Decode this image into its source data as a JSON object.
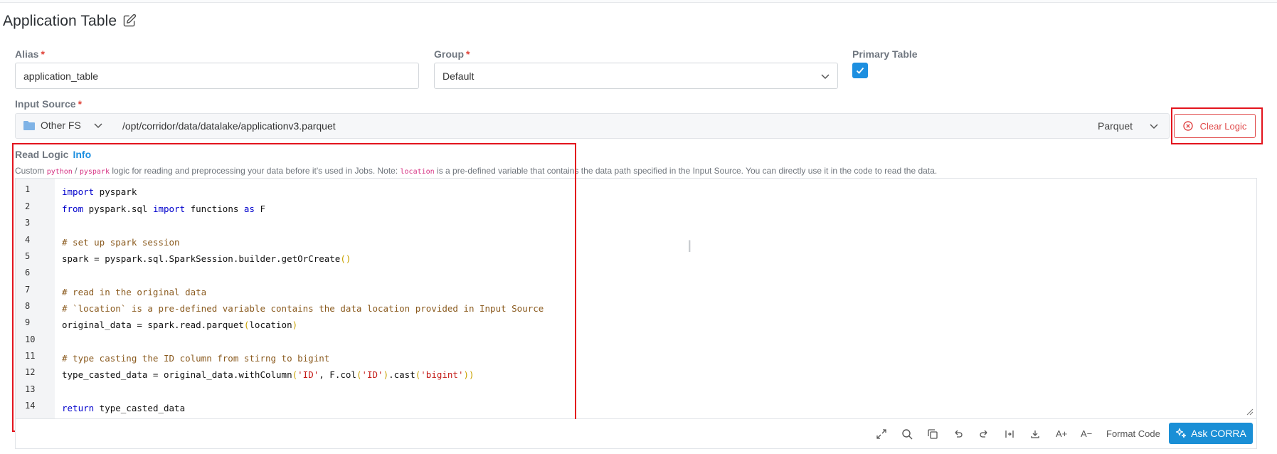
{
  "header": {
    "title": "Application Table"
  },
  "alias": {
    "label": "Alias",
    "required_mark": "*",
    "value": "application_table"
  },
  "group": {
    "label": "Group",
    "required_mark": "*",
    "value": "Default"
  },
  "primary_table": {
    "label": "Primary Table",
    "checked": true
  },
  "input_source": {
    "label": "Input Source",
    "required_mark": "*",
    "fs_type": "Other FS",
    "path": "/opt/corridor/data/datalake/applicationv3.parquet",
    "format": "Parquet"
  },
  "clear_logic": {
    "label": "Clear Logic"
  },
  "read_logic": {
    "label": "Read Logic",
    "info_label": "Info",
    "desc_prefix": "Custom ",
    "desc_python": "python",
    "desc_sep": " / ",
    "desc_pyspark": "pyspark",
    "desc_mid": " logic for reading and preprocessing your data before it's used in Jobs. Note: ",
    "desc_location": "location",
    "desc_suffix": " is a pre-defined variable that contains the data path specified in the Input Source. You can directly use it in the code to read the data."
  },
  "code": {
    "line_numbers": [
      "1",
      "2",
      "3",
      "4",
      "5",
      "6",
      "7",
      "8",
      "9",
      "10",
      "11",
      "12",
      "13",
      "14"
    ],
    "l1_kw": "import",
    "l1_rest": " pyspark",
    "l2_kw1": "from",
    "l2_mid": " pyspark.sql ",
    "l2_kw2": "import",
    "l2_mid2": " functions ",
    "l2_kw3": "as",
    "l2_end": " F",
    "l4": "# set up spark session",
    "l5_a": "spark = pyspark.sql.SparkSession.builder.getOrCreate",
    "l5_p": "()",
    "l7": "# read in the original data",
    "l8": "# `location` is a pre-defined variable contains the data location provided in Input Source",
    "l9_a": "original_data = spark.read.parquet",
    "l9_p1": "(",
    "l9_b": "location",
    "l9_p2": ")",
    "l11": "# type casting the ID column from stirng to bigint",
    "l12_a": "type_casted_data = original_data.withColumn",
    "l12_p1": "(",
    "l12_s1": "'ID'",
    "l12_b": ", F.col",
    "l12_p2": "(",
    "l12_s2": "'ID'",
    "l12_p3": ")",
    "l12_c": ".cast",
    "l12_p4": "(",
    "l12_s3": "'bigint'",
    "l12_p5": "))",
    "l14_kw": "return",
    "l14_rest": " type_casted_data"
  },
  "toolbar": {
    "icons": [
      "expand-icon",
      "search-icon",
      "copy-icon",
      "undo-icon",
      "redo-icon",
      "wrap-icon",
      "download-icon",
      "font-increase-icon",
      "font-decrease-icon"
    ],
    "font_up": "A+",
    "font_down": "A−",
    "format_code": "Format Code",
    "ask": "Ask CORRA"
  },
  "colors": {
    "accent": "#1d8fe0",
    "danger": "#e04949",
    "ask_button": "#1a8fd6",
    "highlight_box": "#e3141d"
  }
}
